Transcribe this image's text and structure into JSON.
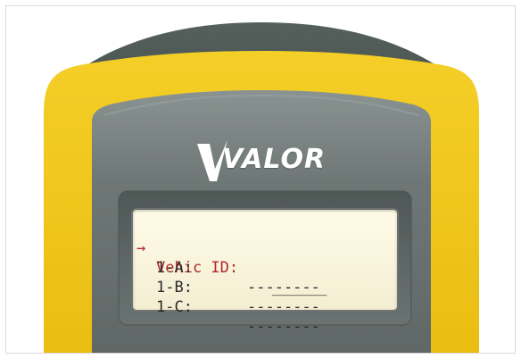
{
  "device": {
    "brand": "VALOR",
    "colors": {
      "housing": "#efc418",
      "bezel": "#6c7573",
      "lcd_background": "#fbf7e1",
      "selected_text": "#b3262e",
      "text": "#2b2b2b"
    }
  },
  "screen": {
    "cursor_icon": "arrow-right-icon",
    "cursor_glyph": "→",
    "rows": [
      {
        "label": "Vehic ID:",
        "value": "______"
      },
      {
        "label": "1-A:",
        "value": "--------"
      },
      {
        "label": "1-B:",
        "value": "--------"
      },
      {
        "label": "1-C:",
        "value": "--------"
      }
    ]
  }
}
